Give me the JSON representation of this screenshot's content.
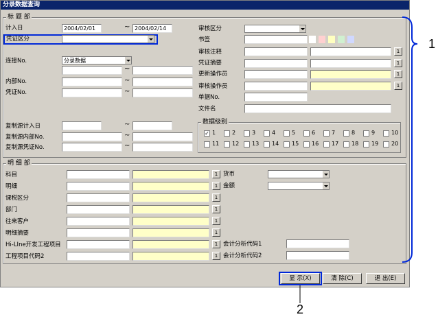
{
  "window_title": "分录数据查询",
  "header": {
    "title": "标 题 部",
    "fields": {
      "entry_date_label": "计入日",
      "entry_date_from": "2004/02/01",
      "entry_date_to": "2004/02/14",
      "voucher_type_label": "凭证区分",
      "link_no_label": "连接No.",
      "link_no_select": "分录数据",
      "internal_no_label": "内部No.",
      "voucher_no_label": "凭证No.",
      "review_type_label": "审核区分",
      "bookmark_label": "书签",
      "review_note_label": "审核注释",
      "voucher_summary_label": "凭证摘要",
      "update_operator_label": "更新操作员",
      "review_operator_label": "审核操作员",
      "doc_no_label": "单据No.",
      "file_name_label": "文件名",
      "copy_source_date_label": "复制源计入日",
      "copy_source_internal_label": "复制源内部No.",
      "copy_source_voucher_label": "复制源凭证No.",
      "tilde": "~",
      "ellipsis": "1"
    },
    "data_level": {
      "title": "数据级别",
      "checkmark": "✓",
      "row1": [
        "1",
        "2",
        "3",
        "4",
        "5",
        "6",
        "7",
        "8",
        "9",
        "10"
      ],
      "row2": [
        "11",
        "12",
        "13",
        "14",
        "15",
        "16",
        "17",
        "18",
        "19",
        "20"
      ],
      "checked": [
        "1"
      ]
    }
  },
  "detail": {
    "title": "明 细 部",
    "labels": [
      "科目",
      "明细",
      "课税区分",
      "部门",
      "往来客户",
      "明细摘要",
      "Hi-LIne开发工程项目",
      "工程项目代码2"
    ],
    "currency_label": "货币",
    "amount_label": "金额",
    "analysis1_label": "会计分析代码1",
    "analysis2_label": "会计分析代码2"
  },
  "buttons": {
    "display": "显 示(X)",
    "clear": "清 除(C)",
    "exit": "退 出(E)"
  },
  "callouts": {
    "one": "1",
    "two": "2"
  },
  "colors": {
    "highlight": "#0028d8",
    "titlebar": "#0a246a",
    "yellow_field": "#ffffc8",
    "swatches": [
      "#ffffff",
      "#ffd0d0",
      "#ffffc0",
      "#d0f0d0",
      "#d0d8ff"
    ]
  }
}
